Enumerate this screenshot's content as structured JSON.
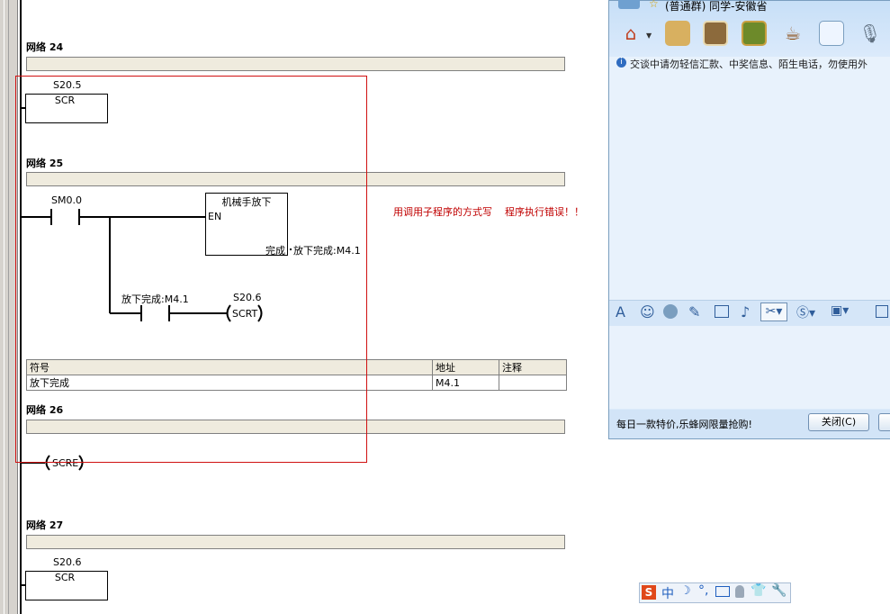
{
  "networks": [
    {
      "title": "网络 24"
    },
    {
      "title": "网络 25"
    },
    {
      "title": "网络 26"
    },
    {
      "title": "网络 27"
    }
  ],
  "n24": {
    "bit": "S20.5",
    "box": "SCR"
  },
  "n25": {
    "contact": "SM0.0",
    "block_title": "机械手放下",
    "en": "EN",
    "out_pin": "完成",
    "out_var": "放下完成:M4.1",
    "contact2": "放下完成:M4.1",
    "coil_bit": "S20.6",
    "coil": "SCRT"
  },
  "symbol_table": {
    "headers": [
      "符号",
      "地址",
      "注释"
    ],
    "rows": [
      [
        "放下完成",
        "M4.1",
        ""
      ]
    ]
  },
  "n26": {
    "coil": "SCRE"
  },
  "n27": {
    "bit": "S20.6",
    "box": "SCR"
  },
  "annotation": "用调用子程序的方式写    程序执行错误！！",
  "qq": {
    "title": "(普通群) 同学-安徽省",
    "notice": "交谈中请勿轻信汇款、中奖信息、陌生电话，勿使用外",
    "ad": "每日一款特价,乐蜂网限量抢购!",
    "close_btn": "关闭(C)"
  },
  "ime": {
    "lang": "中",
    "logo": "S"
  }
}
